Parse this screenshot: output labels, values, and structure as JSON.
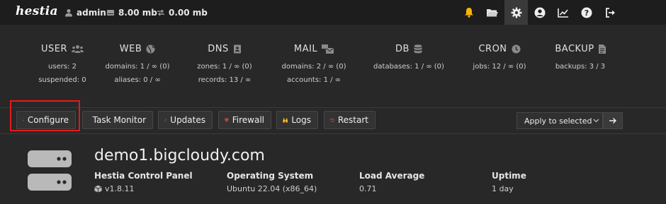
{
  "app": {
    "logo_text": "hestia"
  },
  "topbar": {
    "user": "admin",
    "disk": "8.00 mb",
    "bandwidth": "0.00 mb",
    "icons": [
      "bell-icon",
      "folder-icon",
      "gear-icon",
      "user-circle-icon",
      "chart-line-icon",
      "question-icon",
      "logout-icon"
    ]
  },
  "stats": [
    {
      "title": "USER",
      "icon": "users-icon",
      "line1": "users: 2",
      "line2": "suspended: 0"
    },
    {
      "title": "WEB",
      "icon": "globe-icon",
      "line1": "domains: 1 / ∞ (0)",
      "line2": "aliases: 0 / ∞"
    },
    {
      "title": "DNS",
      "icon": "address-book-icon",
      "line1": "zones: 1 / ∞ (0)",
      "line2": "records: 13 / ∞"
    },
    {
      "title": "MAIL",
      "icon": "mail-bulk-icon",
      "line1": "domains: 2 / ∞ (0)",
      "line2": "accounts: 1 / ∞"
    },
    {
      "title": "DB",
      "icon": "database-icon",
      "line1": "databases: 1 / ∞ (0)",
      "line2": ""
    },
    {
      "title": "CRON",
      "icon": "clock-icon",
      "line1": "jobs: 12 / ∞ (0)",
      "line2": ""
    },
    {
      "title": "BACKUP",
      "icon": "file-icon",
      "line1": "backups: 3 / 3",
      "line2": ""
    }
  ],
  "toolbar": {
    "configure": "Configure",
    "task_monitor": "Task Monitor",
    "updates": "Updates",
    "firewall": "Firewall",
    "logs": "Logs",
    "restart": "Restart",
    "apply_selected": "Apply to selected",
    "colors": {
      "configure": "#e04a5f",
      "task_monitor": "#4a8fe0",
      "updates": "#3fb24b",
      "firewall": "#e04040",
      "logs": "#f0b429",
      "restart": "#e04040"
    }
  },
  "server": {
    "hostname": "demo1.bigcloudy.com",
    "panel_label": "Hestia Control Panel",
    "panel_version": "v1.8.11",
    "os_label": "Operating System",
    "os_value": "Ubuntu 22.04 (x86_64)",
    "load_label": "Load Average",
    "load_value": "0.71",
    "uptime_label": "Uptime",
    "uptime_value": "1 day"
  }
}
